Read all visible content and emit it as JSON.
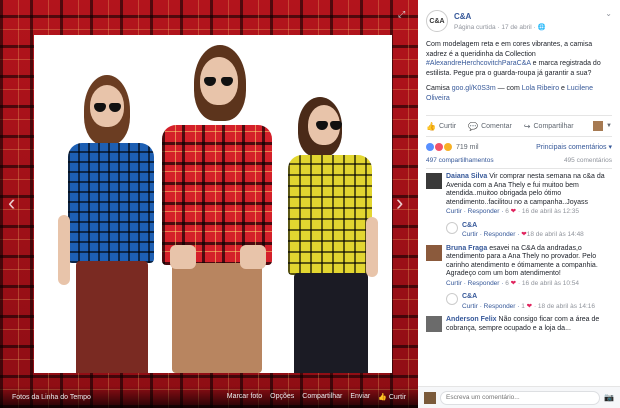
{
  "viewer": {
    "album_label": "Fotos da Linha do Tempo",
    "actions": [
      "Marcar foto",
      "Opções",
      "Compartilhar",
      "Enviar",
      "Curtir"
    ],
    "prev_icon": "chevron-left-icon",
    "next_icon": "chevron-right-icon"
  },
  "post": {
    "page_name": "C&A",
    "logo_text": "C&A",
    "meta": "Página curtida · 17 de abril · 🌐",
    "caption_pre": "Com modelagem reta e em cores vibrantes, a camisa xadrez é a queridinha da Collection ",
    "hashtag": "#AlexandreHerchcovitchParaC&A",
    "caption_post": " e marca registrada do estilista. Pegue pra o guarda-roupa já garantir a sua?",
    "with_prefix": "Camisa",
    "with_link": "goo.gl/K0S3m",
    "with_mid": " — com ",
    "with_p1": "Lola Ribeiro",
    "with_and": " e ",
    "with_p2": "Lucilene Oliveira",
    "actions": [
      "Curtir",
      "Comentar",
      "Compartilhar"
    ],
    "reaction_count": "719 mil",
    "sort_label": "Principais comentários ▾",
    "shares": "497 compartilhamentos",
    "comments_count": "495 comentários"
  },
  "comments": [
    {
      "name": "Daiana Silva",
      "text": "Vir comprar nesta semana na c&a da Avenida com a Ana Thely e fui muitoo bem atendida..muitoo obrigada pelo ótimo atendimento..facilitou no a campanha..Joyass",
      "meta": "Curtir · Responder · ",
      "likes": "6",
      "date": " · 16 de abril às 12:35",
      "reply": false,
      "avatar": "#3a3a3a"
    },
    {
      "name": "C&A",
      "text": "",
      "meta": "Curtir · Responder · ",
      "likes": "",
      "date": "18 de abril às 14:48",
      "reply": true,
      "avatar": "#ffffff"
    },
    {
      "name": "Bruna Fraga",
      "text": "esavei na C&A da andradas,o atendimento para a Ana Thely no provador. Pelo carinho atendimento e ótimamente a companhia. Agradeço com um bom atendimento!",
      "meta": "Curtir · Responder · ",
      "likes": "6",
      "date": " · 16 de abril às 10:54",
      "reply": false,
      "avatar": "#8b5a3c"
    },
    {
      "name": "C&A",
      "text": "",
      "meta": "Curtir · Responder · ",
      "likes": "1",
      "date": " · 18 de abril às 14:16",
      "reply": true,
      "avatar": "#ffffff"
    },
    {
      "name": "Anderson Felix",
      "text": "Não consigo ficar com a área de cobrança, sempre ocupado e a loja da...",
      "meta": "",
      "likes": "",
      "date": "",
      "reply": false,
      "avatar": "#6b6b6b"
    }
  ],
  "composer": {
    "placeholder": "Escreva um comentário..."
  }
}
